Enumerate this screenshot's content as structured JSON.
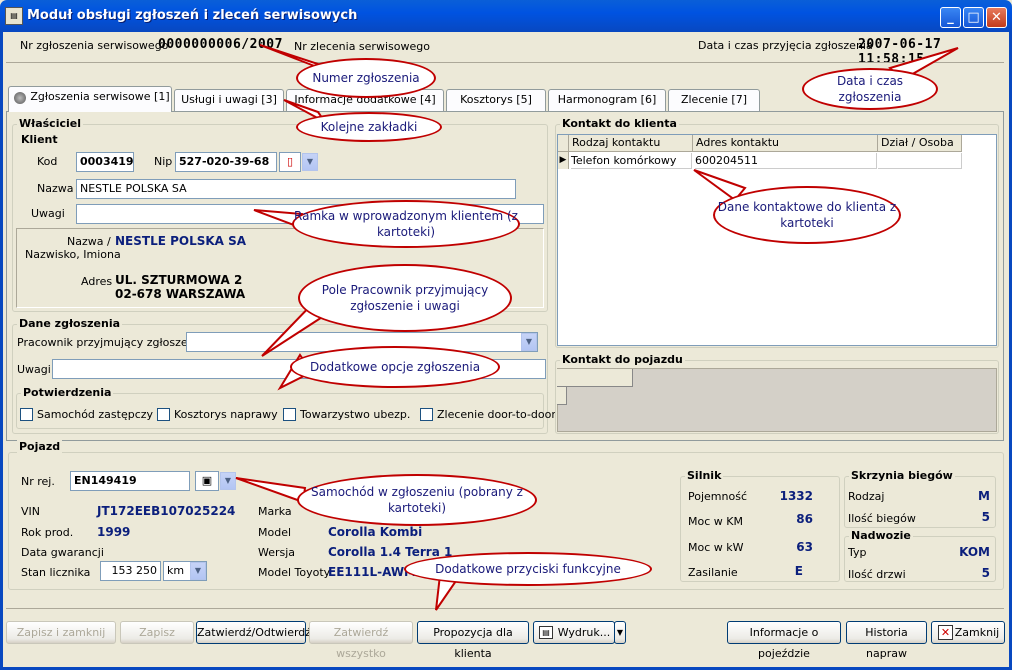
{
  "window": {
    "title": "Moduł obsługi zgłoszeń i zleceń serwisowych",
    "icon": "app-icon",
    "minimize": "_",
    "maximize": "□",
    "close": "✕"
  },
  "header": {
    "nr_label": "Nr zgłoszenia serwisowego",
    "nr_value": "0000000006/2007",
    "zlecenie_label": "Nr zlecenia serwisowego",
    "data_label": "Data i czas przyjęcia zgłoszenia",
    "data_value": "2007-06-17 11:58:15"
  },
  "tabs": [
    {
      "label": "Zgłoszenia serwisowe [1]"
    },
    {
      "label": "Usługi i uwagi [3]"
    },
    {
      "label": "Informacje dodatkowe [4]"
    },
    {
      "label": "Kosztorys [5]"
    },
    {
      "label": "Harmonogram [6]"
    },
    {
      "label": "Zlecenie [7]"
    }
  ],
  "owner": {
    "title": "Właściciel",
    "client_title": "Klient",
    "kod_label": "Kod",
    "kod_value": "0003419",
    "nip_label": "Nip",
    "nip_value": "527-020-39-68",
    "nazwa_label": "Nazwa",
    "nazwa_value": "NESTLE POLSKA SA",
    "uwagi_label": "Uwagi",
    "uwagi_value": "",
    "name_label1": "Nazwa /",
    "name_label2": "Nazwisko, Imiona",
    "name_value": "NESTLE POLSKA SA",
    "adres_label": "Adres",
    "adres_line1": "UL. SZTURMOWA 2",
    "adres_line2": "02-678 WARSZAWA"
  },
  "zgloszenie": {
    "title": "Dane zgłoszenia",
    "pracownik_label": "Pracownik przyjmujący zgłoszenie",
    "pracownik_value": "",
    "uwagi_label": "Uwagi",
    "uwagi_value": "",
    "potw_title": "Potwierdzenia",
    "checks": [
      {
        "label": "Samochód zastępczy",
        "checked": false
      },
      {
        "label": "Kosztorys naprawy",
        "checked": false
      },
      {
        "label": "Towarzystwo ubezp.",
        "checked": false
      },
      {
        "label": "Zlecenie door-to-door",
        "checked": false
      }
    ]
  },
  "contact": {
    "title": "Kontakt do klienta",
    "columns": [
      "Rodzaj kontaktu",
      "Adres kontaktu",
      "Dział / Osoba"
    ],
    "rows": [
      {
        "type": "Telefon komórkowy",
        "address": "600204511",
        "person": ""
      }
    ]
  },
  "vehicle_contact": {
    "title": "Kontakt do pojazdu"
  },
  "pojazd": {
    "title": "Pojazd",
    "nr_label": "Nr rej.",
    "nr_value": "EN149419",
    "vin_label": "VIN",
    "vin_value": "JT172EEB107025224",
    "rok_label": "Rok prod.",
    "rok_value": "1999",
    "gwar_label": "Data gwarancji",
    "gwar_value": "",
    "licznik_label": "Stan licznika",
    "licznik_value": "153 250",
    "licznik_unit": "km",
    "marka_label": "Marka",
    "marka_value": "",
    "model_label": "Model",
    "model_value": "Corolla Kombi",
    "wersja_label": "Wersja",
    "wersja_value": "Corolla 1.4 Terra 1",
    "modeltoy_label": "Model Toyoty",
    "modeltoy_value": "EE111L-AWM"
  },
  "silnik": {
    "title": "Silnik",
    "rows": [
      {
        "label": "Pojemność",
        "value": "1332"
      },
      {
        "label": "Moc w KM",
        "value": "86"
      },
      {
        "label": "Moc w kW",
        "value": "63"
      },
      {
        "label": "Zasilanie",
        "value": "E"
      }
    ]
  },
  "skrzynia": {
    "title": "Skrzynia biegów",
    "rows": [
      {
        "label": "Rodzaj",
        "value": "M"
      },
      {
        "label": "Ilość biegów",
        "value": "5"
      }
    ]
  },
  "nadwozie": {
    "title": "Nadwozie",
    "rows": [
      {
        "label": "Typ",
        "value": "KOM"
      },
      {
        "label": "Ilość drzwi",
        "value": "5"
      }
    ]
  },
  "buttons": {
    "zapisz_zamknij": "Zapisz i zamknij",
    "zapisz": "Zapisz",
    "zatwierdz_odtw": "Zatwierdź/Odtwierdź",
    "zatwierdz_wszystko": "Zatwierdź wszystko",
    "propozycja": "Propozycja dla klienta",
    "wydruk": "Wydruk...",
    "info_pojezdzie": "Informacje o pojeździe",
    "historia": "Historia napraw",
    "zamknij": "Zamknij"
  },
  "callouts": {
    "numer": "Numer zgłoszenia",
    "data": "Data i czas zgłoszenia",
    "zakladki": "Kolejne zakładki",
    "ramka": "Ramka w wprowadzonym klientem (z kartoteki)",
    "kontaktowe": "Dane kontaktowe do klienta z kartoteki",
    "pracownik": "Pole Pracownik przyjmujący zgłoszenie i uwagi",
    "opcje": "Dodatkowe opcje zgłoszenia",
    "samochod": "Samochód w zgłoszeniu (pobrany z kartoteki)",
    "przyciski": "Dodatkowe przyciski funkcyjne"
  }
}
